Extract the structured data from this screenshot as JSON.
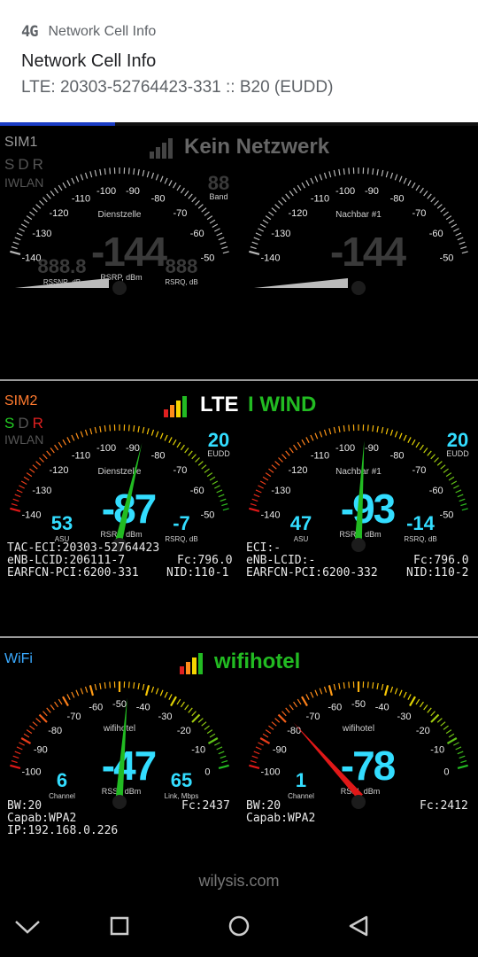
{
  "notification": {
    "app_name": "Network Cell Info",
    "app_icon": "4G",
    "title": "Network Cell Info",
    "subtitle": "LTE: 20303-52764423-331 :: B20 (EUDD)",
    "progress_fraction": 0.24,
    "progress_color": "#1a3cc4"
  },
  "sim1": {
    "label": "SIM1",
    "sdr": [
      "S",
      "D",
      "R"
    ],
    "iwlan": "IWLAN",
    "network": "Kein Netzwerk",
    "band_digits": "88",
    "band_label": "Band",
    "gauge_left": {
      "title": "Dienstzelle",
      "value": "-144",
      "unit": "RSRP, dBm",
      "rssnr_value": "888.8",
      "rssnr_label": "RSSNR, dB",
      "rsrq_value": "888",
      "rsrq_label": "RSRQ, dB",
      "ticks": [
        "-140",
        "-130",
        "-120",
        "-110",
        "-100",
        "-90",
        "-80",
        "-70",
        "-60",
        "-50"
      ]
    },
    "gauge_right": {
      "title": "Nachbar #1",
      "value": "-144",
      "ticks": [
        "-140",
        "-130",
        "-120",
        "-110",
        "-100",
        "-90",
        "-80",
        "-70",
        "-60",
        "-50"
      ]
    }
  },
  "sim2": {
    "label": "SIM2",
    "sdr": [
      "S",
      "D",
      "R"
    ],
    "iwlan": "IWLAN",
    "tech": "LTE",
    "operator": "I WIND",
    "gauge_left": {
      "title": "Dienstzelle",
      "value": "-87",
      "rsrp": -87,
      "unit": "RSRP, dBm",
      "band_digits": "20",
      "band_label": "EUDD",
      "asu_value": "53",
      "asu_label": "ASU",
      "rsrq_value": "-7",
      "rsrq_label": "RSRQ, dB",
      "ticks": [
        "-140",
        "-130",
        "-120",
        "-110",
        "-100",
        "-90",
        "-80",
        "-70",
        "-60",
        "-50"
      ]
    },
    "gauge_right": {
      "title": "Nachbar #1",
      "value": "-93",
      "rsrp": -93,
      "unit": "RSRP, dBm",
      "band_digits": "20",
      "band_label": "EUDD",
      "asu_value": "47",
      "asu_label": "ASU",
      "rsrq_value": "-14",
      "rsrq_label": "RSRQ, dB",
      "ticks": [
        "-140",
        "-130",
        "-120",
        "-110",
        "-100",
        "-90",
        "-80",
        "-70",
        "-60",
        "-50"
      ]
    },
    "info_left": {
      "tac_eci": "TAC-ECI:20303-52764423",
      "enb": "eNB-LCID:206111-7",
      "fc": "Fc:796.0",
      "earfcn": "EARFCN-PCI:6200-331",
      "nid": "NID:110-1"
    },
    "info_right": {
      "eci": "ECI:-",
      "enb": "eNB-LCID:-",
      "fc": "Fc:796.0",
      "earfcn": "EARFCN-PCI:6200-332",
      "nid": "NID:110-2"
    }
  },
  "wifi": {
    "label": "WiFi",
    "ssid": "wifihotel",
    "gauge_left": {
      "title": "wifihotel",
      "value": "-47",
      "rssi": -47,
      "unit": "RSSI, dBm",
      "channel_value": "6",
      "channel_label": "Channel",
      "link_value": "65",
      "link_label": "Link, Mbps",
      "ticks": [
        "-100",
        "-90",
        "-80",
        "-70",
        "-60",
        "-50",
        "-40",
        "-30",
        "-20",
        "-10",
        "0"
      ]
    },
    "gauge_right": {
      "title": "wifihotel",
      "value": "-78",
      "rssi": -78,
      "unit": "RSSI, dBm",
      "channel_value": "1",
      "channel_label": "Channel",
      "ticks": [
        "-100",
        "-90",
        "-80",
        "-70",
        "-60",
        "-50",
        "-40",
        "-30",
        "-20",
        "-10",
        "0"
      ]
    },
    "info_left": {
      "bw": "BW:20",
      "fc": "Fc:2437",
      "capab": "Capab:WPA2",
      "ip": "IP:192.168.0.226"
    },
    "info_right": {
      "bw": "BW:20",
      "fc": "Fc:2412",
      "capab": "Capab:WPA2"
    }
  },
  "footer": {
    "site": "wilysis.com"
  },
  "navbar": {
    "icons": [
      "chevron-down-icon",
      "recents-square-icon",
      "home-circle-icon",
      "back-triangle-icon"
    ]
  },
  "colors": {
    "cyan": "#33ddff",
    "green": "#22bb22",
    "sim2_orange": "#ff7a2e",
    "wifi_blue": "#3aaaff",
    "needle_red": "#e01818"
  }
}
